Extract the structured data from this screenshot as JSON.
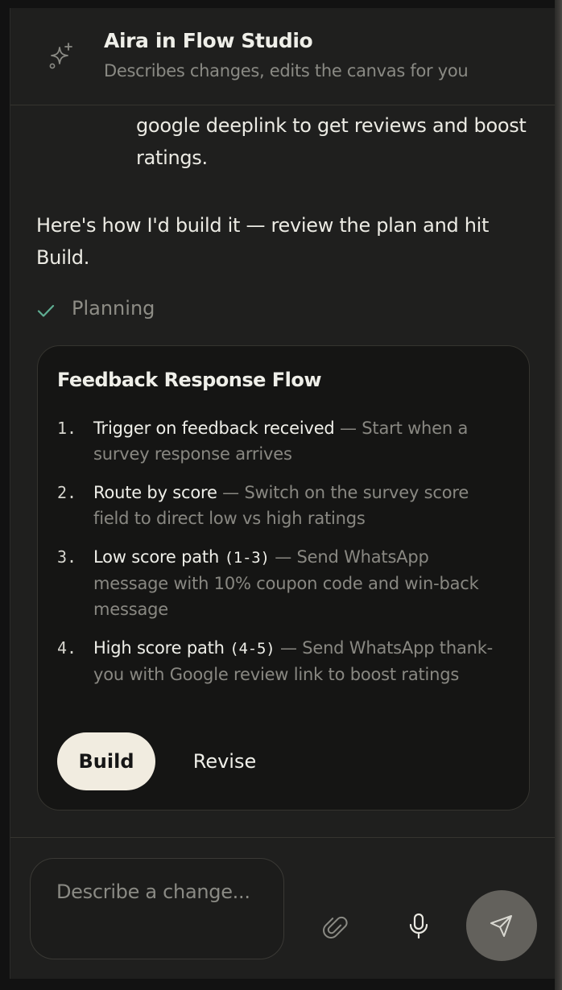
{
  "header": {
    "title": "Aira in Flow Studio",
    "subtitle": "Describes changes, edits the canvas for you",
    "icon": "sparkle-icon"
  },
  "conversation": {
    "user_message_tail": "google deeplink to get reviews and boost ratings.",
    "assistant_intro": "Here's how I'd build it — review the plan and hit Build.",
    "status": {
      "icon": "check-icon",
      "label": "Planning",
      "color": "#5fae93"
    }
  },
  "plan": {
    "title": "Feedback Response Flow",
    "steps": [
      {
        "number": "1.",
        "label": "Trigger on feedback received",
        "label_code": "",
        "description": " — Start when a survey response arrives"
      },
      {
        "number": "2.",
        "label": "Route by score",
        "label_code": "",
        "description": " — Switch on the survey score field to direct low vs high ratings"
      },
      {
        "number": "3.",
        "label": "Low score path ",
        "label_code": "(1-3)",
        "description": " — Send WhatsApp message with 10% coupon code and win-back message"
      },
      {
        "number": "4.",
        "label": "High score path ",
        "label_code": "(4-5)",
        "description": " — Send WhatsApp thank-you with Google review link to boost ratings"
      }
    ],
    "build_label": "Build",
    "revise_label": "Revise"
  },
  "composer": {
    "placeholder": "Describe a change...",
    "attach_icon": "paperclip-icon",
    "mic_icon": "microphone-icon",
    "send_icon": "send-icon"
  },
  "colors": {
    "panel_bg": "#1f1f1e",
    "card_bg": "#151514",
    "primary_button_bg": "#f1ece0",
    "send_button_bg": "#63615c"
  }
}
